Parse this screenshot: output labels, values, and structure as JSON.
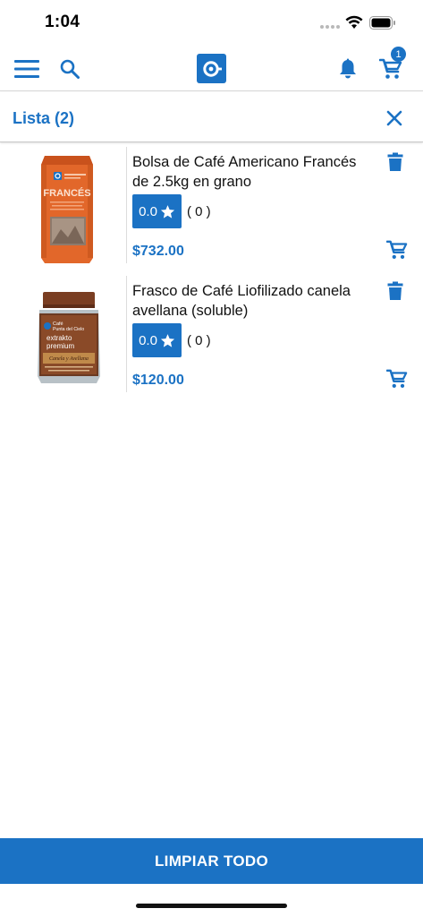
{
  "status_bar": {
    "time": "1:04",
    "icons": [
      "signal-dots-icon",
      "wifi-icon",
      "battery-icon"
    ]
  },
  "header": {
    "icons": [
      "menu-icon",
      "search-icon",
      "app-logo-icon",
      "bell-icon",
      "cart-icon"
    ],
    "cart_badge_count": "1"
  },
  "list": {
    "title": "Lista (2)",
    "close_icon": "close-icon"
  },
  "products": [
    {
      "name": "Bolsa de Café Americano Francés de 2.5kg en grano",
      "rating": "0.0",
      "rating_count": "( 0 )",
      "price": "$732.00",
      "image": "coffee-bag-image",
      "image_text": "FRANCÉS"
    },
    {
      "name": "Frasco de Café Liofilizado canela avellana (soluble)",
      "rating": "0.0",
      "rating_count": "( 0 )",
      "price": "$120.00",
      "image": "coffee-jar-image",
      "image_text": [
        "Café",
        "Punta del Cielo",
        "extrakto",
        "premium",
        "Canela y Avellana"
      ]
    }
  ],
  "footer": {
    "clear_all_label": "LIMPIAR TODO"
  },
  "colors": {
    "accent": "#1b72c4",
    "divider": "#d6d6d6",
    "text": "#111111",
    "coffee_bag": "#e2672a",
    "coffee_jar": "#6b3a22"
  }
}
